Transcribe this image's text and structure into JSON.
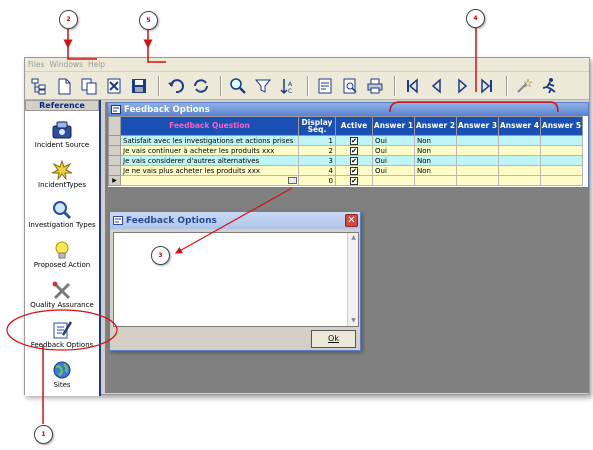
{
  "menu": [
    "Files",
    "Windows",
    "Help"
  ],
  "sidebar": {
    "header": "Reference",
    "items": [
      {
        "label": "Incident Source"
      },
      {
        "label": "IncidentTypes"
      },
      {
        "label": "Investigation Types"
      },
      {
        "label": "Proposed Action"
      },
      {
        "label": "Quality Assurance"
      },
      {
        "label": "Feedback Options"
      },
      {
        "label": "Sites"
      }
    ]
  },
  "grid": {
    "title": "Feedback Options",
    "columns": [
      "Feedback Question",
      "Display Seq.",
      "Active",
      "Answer 1",
      "Answer 2",
      "Answer 3",
      "Answer 4",
      "Answer 5"
    ],
    "rows": [
      {
        "question": "Satisfait avec les investigations et actions prises",
        "seq": "1",
        "active": "✔",
        "a1": "Oui",
        "a2": "Non"
      },
      {
        "question": "Je vais continuer à acheter les produits xxx",
        "seq": "2",
        "active": "✔",
        "a1": "Oui",
        "a2": "Non"
      },
      {
        "question": "Je vais considerer d'autres alternatives",
        "seq": "3",
        "active": "✔",
        "a1": "Oui",
        "a2": "Non"
      },
      {
        "question": "Je ne vais plus acheter les produits xxx",
        "seq": "4",
        "active": "✔",
        "a1": "Oui",
        "a2": "Non"
      },
      {
        "question": "",
        "seq": "0",
        "active": "✔",
        "a1": "",
        "a2": ""
      }
    ],
    "row_indicator": "▶"
  },
  "dialog": {
    "title": "Feedback Options",
    "close": "✕",
    "ok_label": "Ok"
  },
  "callouts": [
    "2",
    "5",
    "4",
    "3",
    "1"
  ],
  "colors": {
    "header_blue": "#1a4fb3",
    "question_header": "#ff60c0",
    "row_cyan": "#bff4f4",
    "row_yellow": "#fffcc8",
    "callout_text": "#c00000",
    "arrow": "#d41010"
  }
}
